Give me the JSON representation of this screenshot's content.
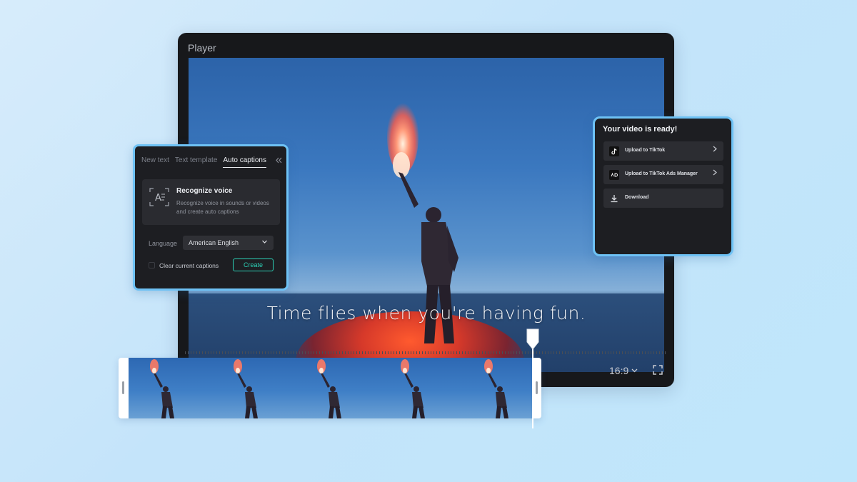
{
  "player": {
    "title": "Player",
    "caption_text": "Time flies when you're having fun.",
    "aspect_ratio": "16:9",
    "aspect_chevron_icon": "chevron-down-icon",
    "fullscreen_icon": "fullscreen-icon"
  },
  "captions_panel": {
    "tabs": [
      {
        "label": "New text",
        "active": false
      },
      {
        "label": "Text template",
        "active": false
      },
      {
        "label": "Auto captions",
        "active": true
      }
    ],
    "collapse_icon": "double-chevron-left-icon",
    "recognize": {
      "icon": "speech-recognition-icon",
      "title": "Recognize voice",
      "description": "Recognize voice in sounds or videos and create auto captions"
    },
    "language_label": "Language",
    "language_value": "American English",
    "clear_label": "Clear current captions",
    "clear_checked": false,
    "create_label": "Create"
  },
  "ready_panel": {
    "title": "Your video is ready!",
    "items": [
      {
        "label": "Upload to TikTok",
        "icon": "tiktok-icon",
        "has_arrow": true
      },
      {
        "label": "Upload to TikTok Ads Manager",
        "icon": "tiktok-ads-icon",
        "has_arrow": true
      },
      {
        "label": "Download",
        "icon": "download-icon",
        "has_arrow": false
      }
    ]
  },
  "colors": {
    "accent_border": "#6ec2f5",
    "create_button": "#2ccfb5",
    "panel_bg": "#1d1e22"
  },
  "timeline": {
    "frame_count": 5
  }
}
